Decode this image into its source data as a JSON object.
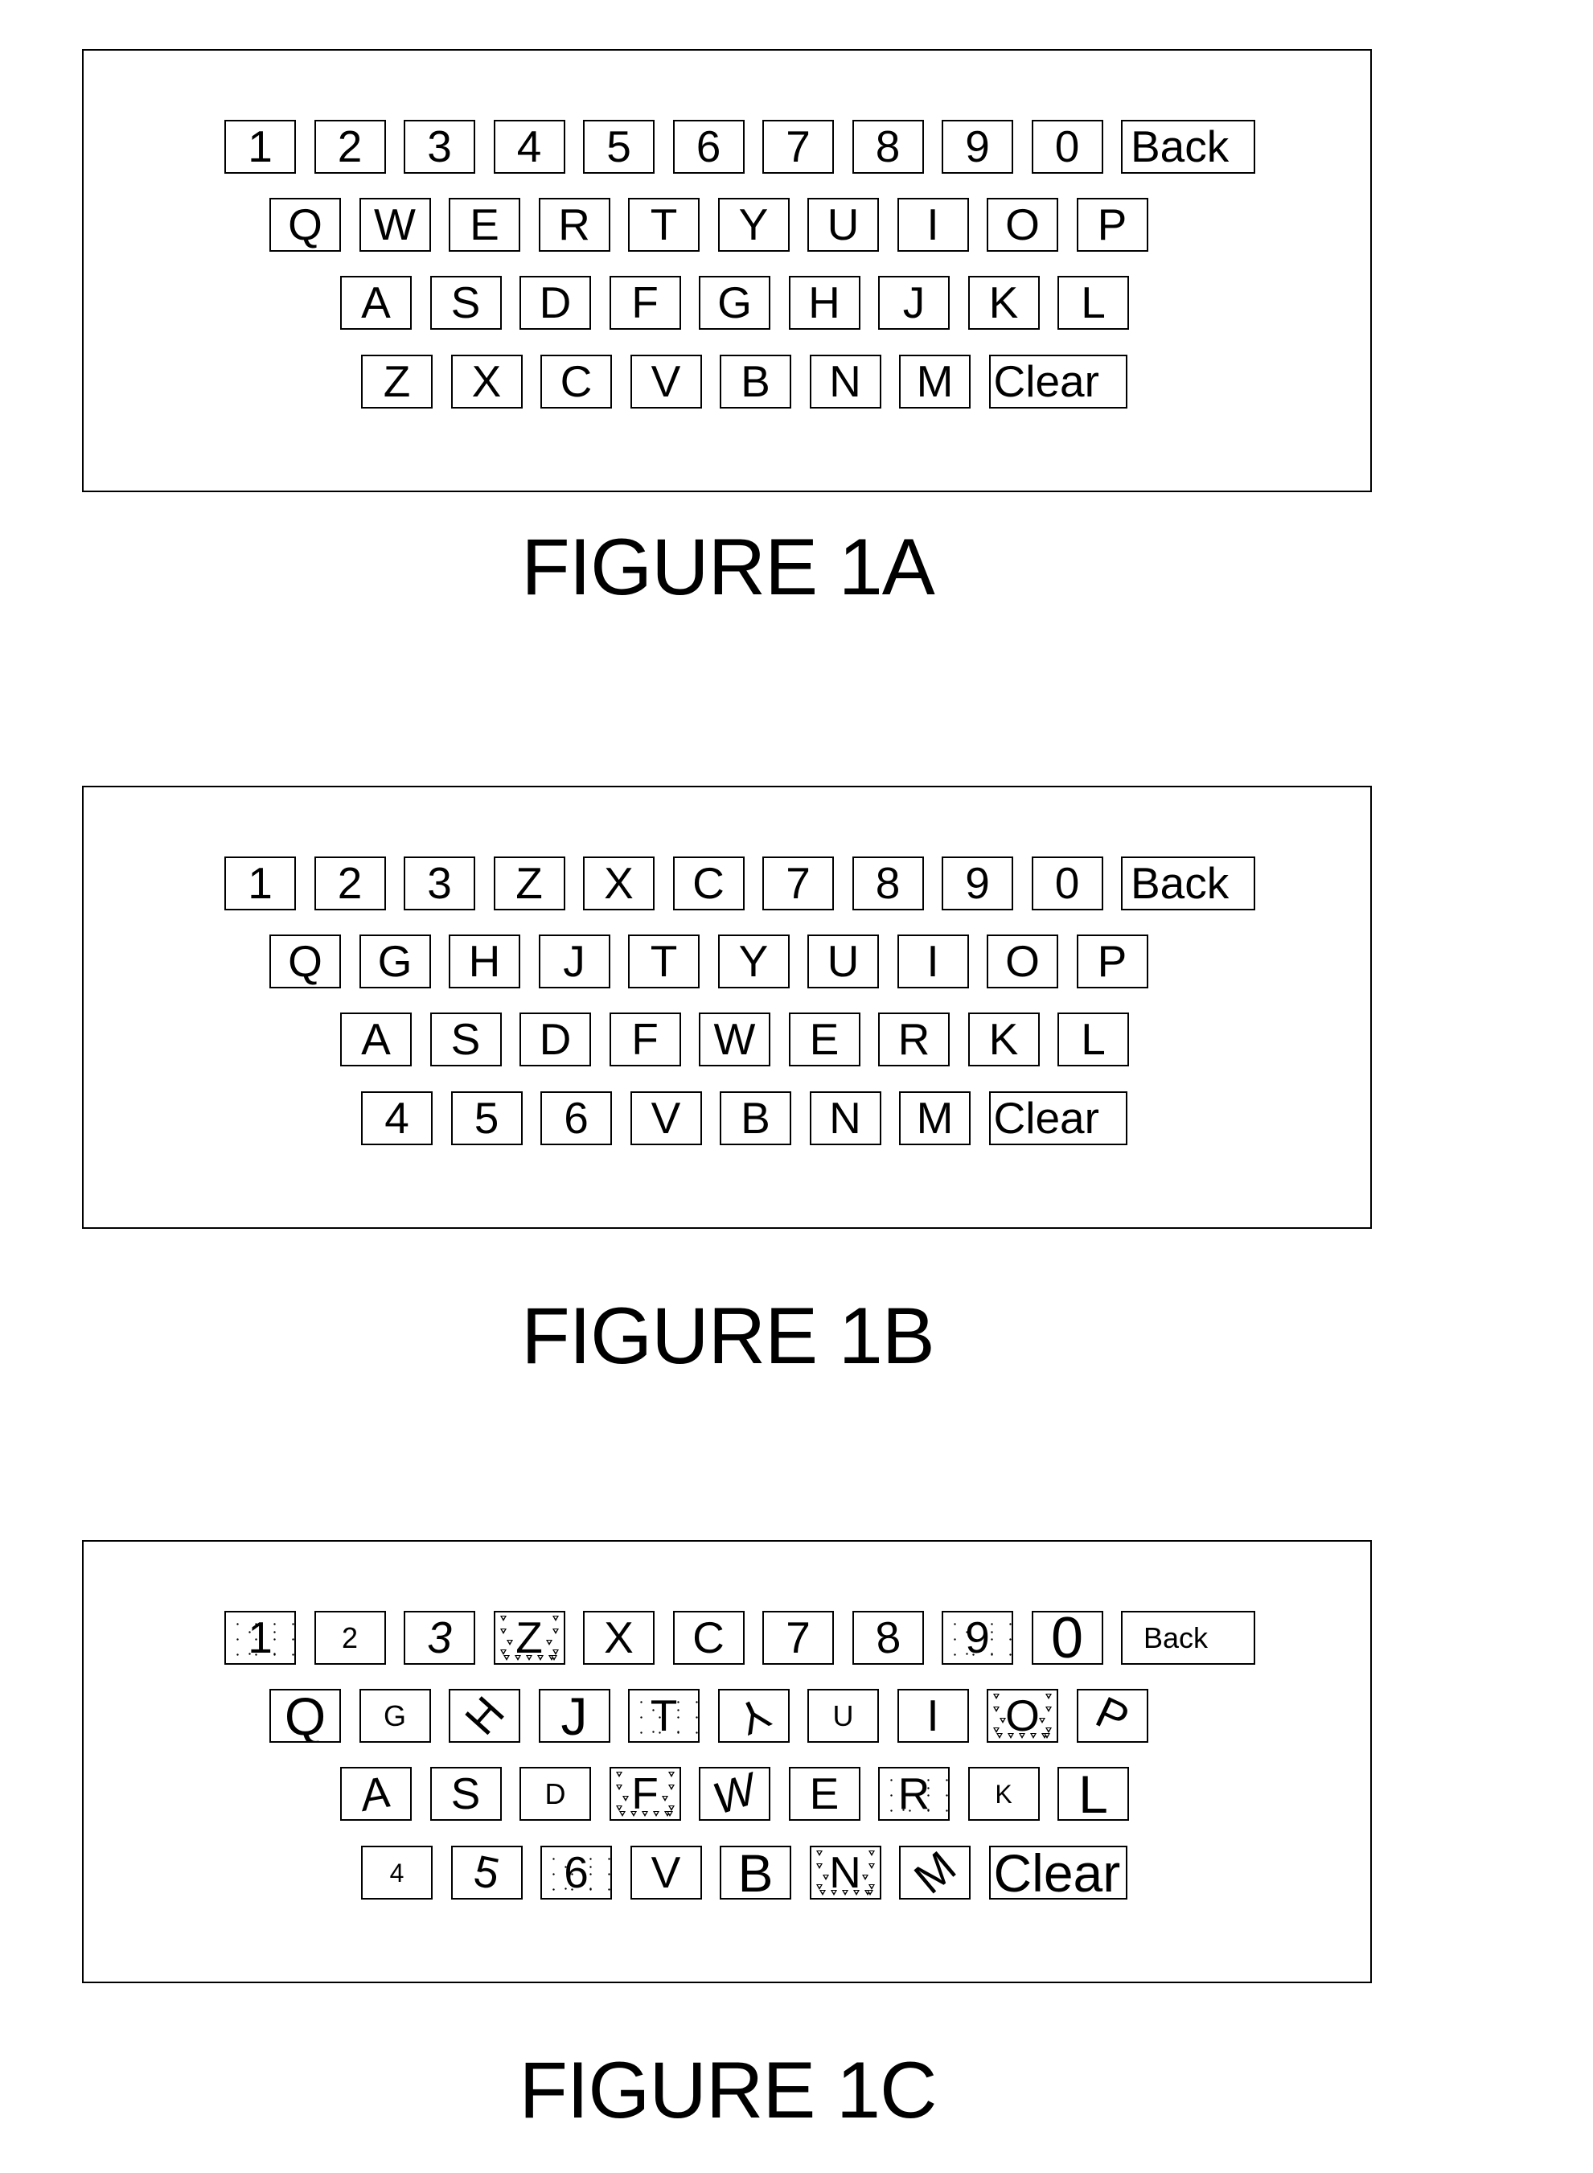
{
  "figures": [
    {
      "caption": "FIGURE 1A",
      "rows": [
        [
          {
            "label": "1"
          },
          {
            "label": "2"
          },
          {
            "label": "3"
          },
          {
            "label": "4"
          },
          {
            "label": "5"
          },
          {
            "label": "6"
          },
          {
            "label": "7"
          },
          {
            "label": "8"
          },
          {
            "label": "9"
          },
          {
            "label": "0"
          },
          {
            "label": "Back",
            "type": "back"
          }
        ],
        [
          {
            "label": "Q"
          },
          {
            "label": "W"
          },
          {
            "label": "E"
          },
          {
            "label": "R"
          },
          {
            "label": "T"
          },
          {
            "label": "Y"
          },
          {
            "label": "U"
          },
          {
            "label": "I"
          },
          {
            "label": "O"
          },
          {
            "label": "P"
          }
        ],
        [
          {
            "label": "A"
          },
          {
            "label": "S"
          },
          {
            "label": "D"
          },
          {
            "label": "F"
          },
          {
            "label": "G"
          },
          {
            "label": "H"
          },
          {
            "label": "J"
          },
          {
            "label": "K"
          },
          {
            "label": "L"
          }
        ],
        [
          {
            "label": "Z"
          },
          {
            "label": "X"
          },
          {
            "label": "C"
          },
          {
            "label": "V"
          },
          {
            "label": "B"
          },
          {
            "label": "N"
          },
          {
            "label": "M"
          },
          {
            "label": "Clear",
            "type": "clear"
          }
        ]
      ]
    },
    {
      "caption": "FIGURE 1B",
      "rows": [
        [
          {
            "label": "1"
          },
          {
            "label": "2"
          },
          {
            "label": "3"
          },
          {
            "label": "Z"
          },
          {
            "label": "X"
          },
          {
            "label": "C"
          },
          {
            "label": "7"
          },
          {
            "label": "8"
          },
          {
            "label": "9"
          },
          {
            "label": "0"
          },
          {
            "label": "Back",
            "type": "back"
          }
        ],
        [
          {
            "label": "Q"
          },
          {
            "label": "G"
          },
          {
            "label": "H"
          },
          {
            "label": "J"
          },
          {
            "label": "T"
          },
          {
            "label": "Y"
          },
          {
            "label": "U"
          },
          {
            "label": "I"
          },
          {
            "label": "O"
          },
          {
            "label": "P"
          }
        ],
        [
          {
            "label": "A"
          },
          {
            "label": "S"
          },
          {
            "label": "D"
          },
          {
            "label": "F"
          },
          {
            "label": "W"
          },
          {
            "label": "E"
          },
          {
            "label": "R"
          },
          {
            "label": "K"
          },
          {
            "label": "L"
          }
        ],
        [
          {
            "label": "4"
          },
          {
            "label": "5"
          },
          {
            "label": "6"
          },
          {
            "label": "V"
          },
          {
            "label": "B"
          },
          {
            "label": "N"
          },
          {
            "label": "M"
          },
          {
            "label": "Clear",
            "type": "clear"
          }
        ]
      ]
    },
    {
      "caption": "FIGURE 1C",
      "rows": [
        [
          {
            "label": "1",
            "pattern": "speckled"
          },
          {
            "label": "2",
            "size": "small"
          },
          {
            "label": "3",
            "style": "italic"
          },
          {
            "label": "Z",
            "pattern": "triangles"
          },
          {
            "label": "X"
          },
          {
            "label": "C"
          },
          {
            "label": "7"
          },
          {
            "label": "8",
            "orientation": "tilted-slight"
          },
          {
            "label": "9",
            "pattern": "speckled"
          },
          {
            "label": "0",
            "size": "xlarge"
          },
          {
            "label": "Back",
            "type": "back",
            "size": "small"
          }
        ],
        [
          {
            "label": "Q",
            "size": "large"
          },
          {
            "label": "G",
            "size": "small"
          },
          {
            "label": "H",
            "orientation": "rotated-diagonal"
          },
          {
            "label": "J",
            "size": "large"
          },
          {
            "label": "T",
            "pattern": "speckled"
          },
          {
            "label": "Y",
            "orientation": "rotated-inverted"
          },
          {
            "label": "U",
            "size": "small"
          },
          {
            "label": "I"
          },
          {
            "label": "O",
            "pattern": "triangles"
          },
          {
            "label": "P",
            "orientation": "rotated-tilted"
          }
        ],
        [
          {
            "label": "A",
            "orientation": "slanted"
          },
          {
            "label": "S"
          },
          {
            "label": "D",
            "size": "small"
          },
          {
            "label": "F",
            "pattern": "triangles"
          },
          {
            "label": "W",
            "orientation": "slanted-strong"
          },
          {
            "label": "E"
          },
          {
            "label": "R",
            "pattern": "speckled"
          },
          {
            "label": "K",
            "size": "xsmall"
          },
          {
            "label": "L",
            "size": "large"
          }
        ],
        [
          {
            "label": "4",
            "size": "xsmall"
          },
          {
            "label": "5",
            "orientation": "tilted"
          },
          {
            "label": "6",
            "pattern": "speckled"
          },
          {
            "label": "V"
          },
          {
            "label": "B",
            "size": "large"
          },
          {
            "label": "N",
            "pattern": "triangles"
          },
          {
            "label": "M",
            "orientation": "rotated-diagonal-left"
          },
          {
            "label": "Clear",
            "type": "clear",
            "size": "large"
          }
        ]
      ]
    }
  ]
}
